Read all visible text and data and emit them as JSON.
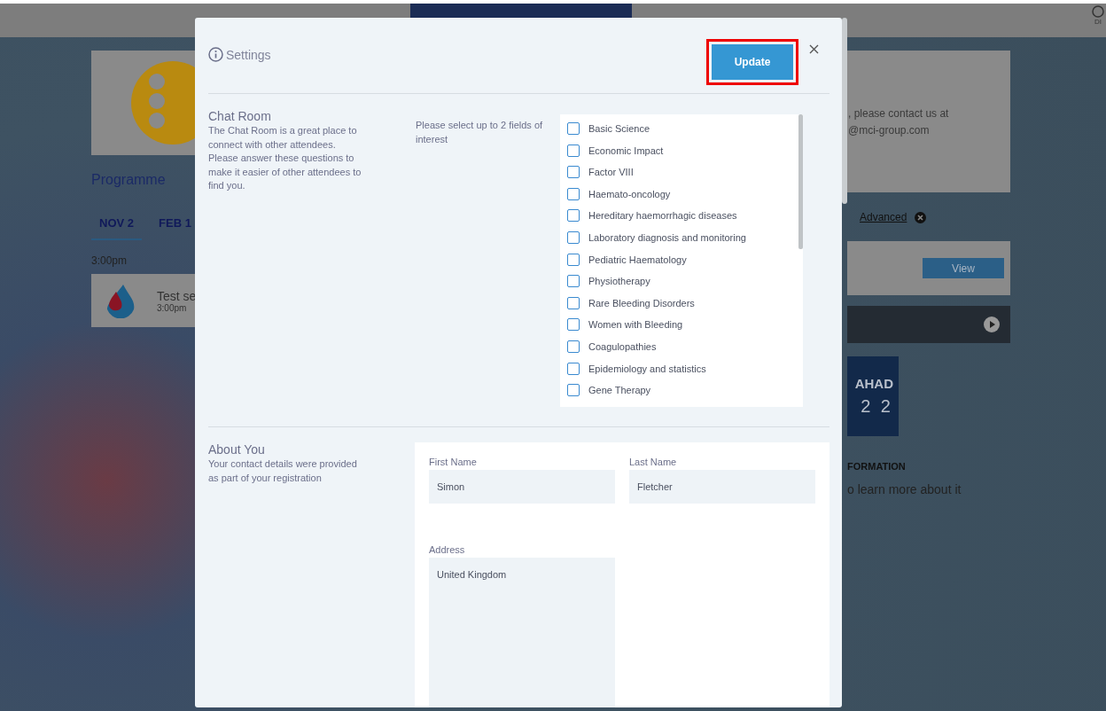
{
  "page": {
    "top_bar": {
      "account_label": "DI"
    },
    "programme": {
      "title": "Programme",
      "tabs": [
        {
          "label": "NOV 2",
          "selected": true
        },
        {
          "label": "FEB 1",
          "selected": false
        }
      ],
      "time": "3:00pm",
      "session": {
        "title": "Test se",
        "time": "3:00pm"
      }
    },
    "contact": {
      "lines": [
        ", please contact us at",
        "@mci-group.com"
      ]
    },
    "filter": {
      "link": "Advanced"
    },
    "view_button": "View",
    "logo_text": {
      "line_1": "AHAD",
      "line_2": "2 2"
    },
    "info": {
      "heading": "FORMATION",
      "text": "o learn more about it"
    }
  },
  "modal": {
    "title": "Settings",
    "update_button": "Update",
    "highlighted": true,
    "chat_room": {
      "title": "Chat Room",
      "description": "The Chat Room is a great place to connect with other attendees. Please answer these questions to make it easier of other attendees to find you.",
      "prompt": "Please select up to 2 fields of interest",
      "options": [
        {
          "label": "Basic Science",
          "checked": false
        },
        {
          "label": "Economic Impact",
          "checked": false
        },
        {
          "label": "Factor VIII",
          "checked": false
        },
        {
          "label": "Haemato-oncology",
          "checked": false
        },
        {
          "label": "Hereditary haemorrhagic diseases",
          "checked": false
        },
        {
          "label": "Laboratory diagnosis and monitoring",
          "checked": false
        },
        {
          "label": "Pediatric Haematology",
          "checked": false
        },
        {
          "label": "Physiotherapy",
          "checked": false
        },
        {
          "label": "Rare Bleeding Disorders",
          "checked": false
        },
        {
          "label": "Women with Bleeding",
          "checked": false
        },
        {
          "label": "Coagulopathies",
          "checked": false
        },
        {
          "label": "Epidemiology and statistics",
          "checked": false
        },
        {
          "label": "Gene Therapy",
          "checked": false
        }
      ]
    },
    "about_you": {
      "title": "About You",
      "description": "Your contact details were provided as part of your registration",
      "first_name": {
        "label": "First Name",
        "value": "Simon"
      },
      "last_name": {
        "label": "Last Name",
        "value": "Fletcher"
      },
      "address": {
        "label": "Address",
        "value": "United Kingdom"
      }
    }
  }
}
